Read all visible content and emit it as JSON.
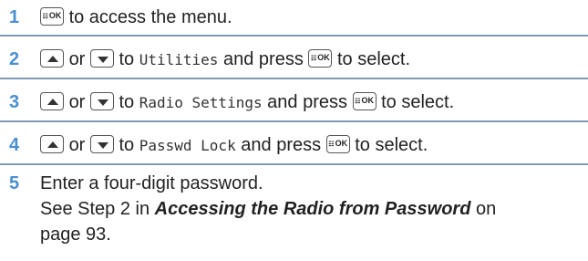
{
  "steps": [
    {
      "number": "1",
      "to_access": "to access the menu."
    },
    {
      "number": "2",
      "or": "or",
      "to": "to",
      "item": "Utilities",
      "press": "and press",
      "select": "to select."
    },
    {
      "number": "3",
      "or": "or",
      "to": "to",
      "item": "Radio Settings",
      "press": "and press",
      "select": "to select."
    },
    {
      "number": "4",
      "or": "or",
      "to": "to",
      "item": "Passwd Lock",
      "press": "and press",
      "select": "to select."
    },
    {
      "number": "5",
      "line1": "Enter a four-digit password.",
      "line2_prefix": "See Step 2 in",
      "line2_ref": "Accessing the Radio from Password",
      "line2_suffix": "on",
      "line3": "page 93."
    }
  ],
  "keys": {
    "ok_label": "OK",
    "ok_icon": "menu-grid-icon",
    "up_icon": "up-arrow-icon",
    "down_icon": "down-arrow-icon"
  },
  "colors": {
    "step_number": "#4a8fd0",
    "rule": "#7f9ab5"
  }
}
